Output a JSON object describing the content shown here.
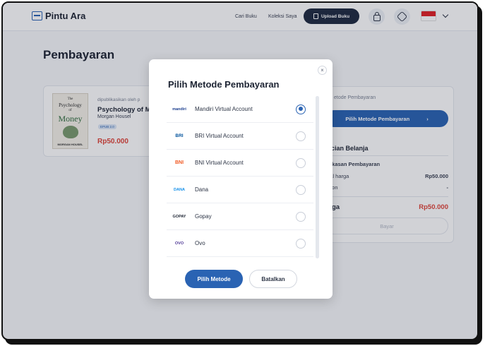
{
  "header": {
    "logo_text": "Pintu Ara",
    "logo_badge": "ARA",
    "nav": [
      "Cari Buku",
      "Koleksi Saya"
    ],
    "upload_label": "Upload Buku"
  },
  "page": {
    "title": "Pembayaran"
  },
  "product": {
    "publisher": "dipublikasikan oleh p",
    "title": "Psychology of M",
    "author": "Morgan Housel",
    "edition": "EPUB 2.0",
    "price": "Rp50.000",
    "cover": {
      "line1": "The",
      "line2": "Psychology",
      "line3": "of",
      "line4": "Money",
      "author": "MORGAN HOUSEL"
    }
  },
  "summary": {
    "method_label": "etode Pembayaran",
    "pay_button": "Pilih Metode Pembayaran",
    "heading": "incian Belanja",
    "subheading": "ngkasan Pembayaran",
    "rows": [
      {
        "label": "otal harga",
        "value": "Rp50.000"
      },
      {
        "label": "iskon",
        "value": "-"
      }
    ],
    "total_label": "arga",
    "total_value": "Rp50.000",
    "bayar_button": "Bayar"
  },
  "modal": {
    "title": "Pilih Metode Pembayaran",
    "close": "×",
    "methods": [
      {
        "label": "Mandiri Virtual Account",
        "logo": "mandiri",
        "selected": true
      },
      {
        "label": "BRI Virtual Account",
        "logo": "BRI",
        "selected": false
      },
      {
        "label": "BNI Virtual Account",
        "logo": "BNI",
        "selected": false
      },
      {
        "label": "Dana",
        "logo": "DANA",
        "selected": false
      },
      {
        "label": "Gopay",
        "logo": "GOPAY",
        "selected": false
      },
      {
        "label": "Ovo",
        "logo": "OVO",
        "selected": false
      }
    ],
    "primary_button": "Pilih Metode",
    "secondary_button": "Batalkan"
  },
  "colors": {
    "primary": "#2a63b3",
    "price": "#e0453a",
    "dark": "#1e2a40"
  }
}
